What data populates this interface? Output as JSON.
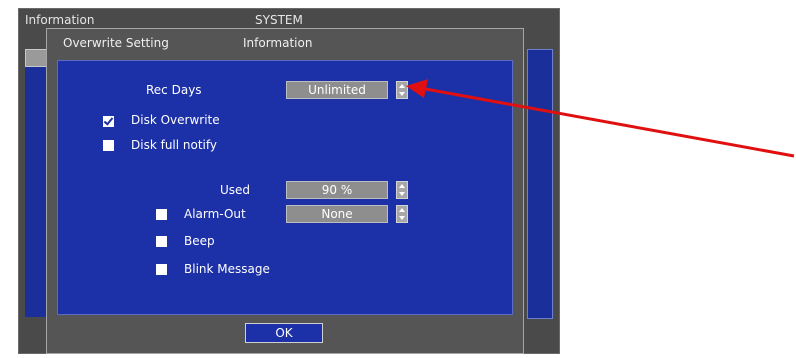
{
  "background_window": {
    "title_left": "Information",
    "title_right": "SYSTEM"
  },
  "dialog": {
    "tabs": [
      {
        "label": "Overwrite Setting"
      },
      {
        "label": "Information"
      }
    ],
    "rec_days": {
      "label": "Rec Days",
      "value": "Unlimited"
    },
    "disk_overwrite": {
      "label": "Disk Overwrite",
      "checked": true
    },
    "disk_full_notify": {
      "label": "Disk full notify",
      "checked": false
    },
    "used": {
      "label": "Used",
      "value": "90 %"
    },
    "alarm_out": {
      "label": "Alarm-Out",
      "value": "None",
      "checked": false
    },
    "beep": {
      "label": "Beep",
      "checked": false
    },
    "blink_message": {
      "label": "Blink Message",
      "checked": false
    },
    "ok_label": "OK"
  },
  "colors": {
    "panel_blue": "#1c30a8",
    "dialog_gray": "#555555",
    "field_gray": "#8e8e8e",
    "arrow_red": "#e01010"
  },
  "icons": {
    "spinner": "up-down-spinner-icon",
    "checkbox": "checkbox-icon",
    "annotation": "red-arrow-icon"
  }
}
